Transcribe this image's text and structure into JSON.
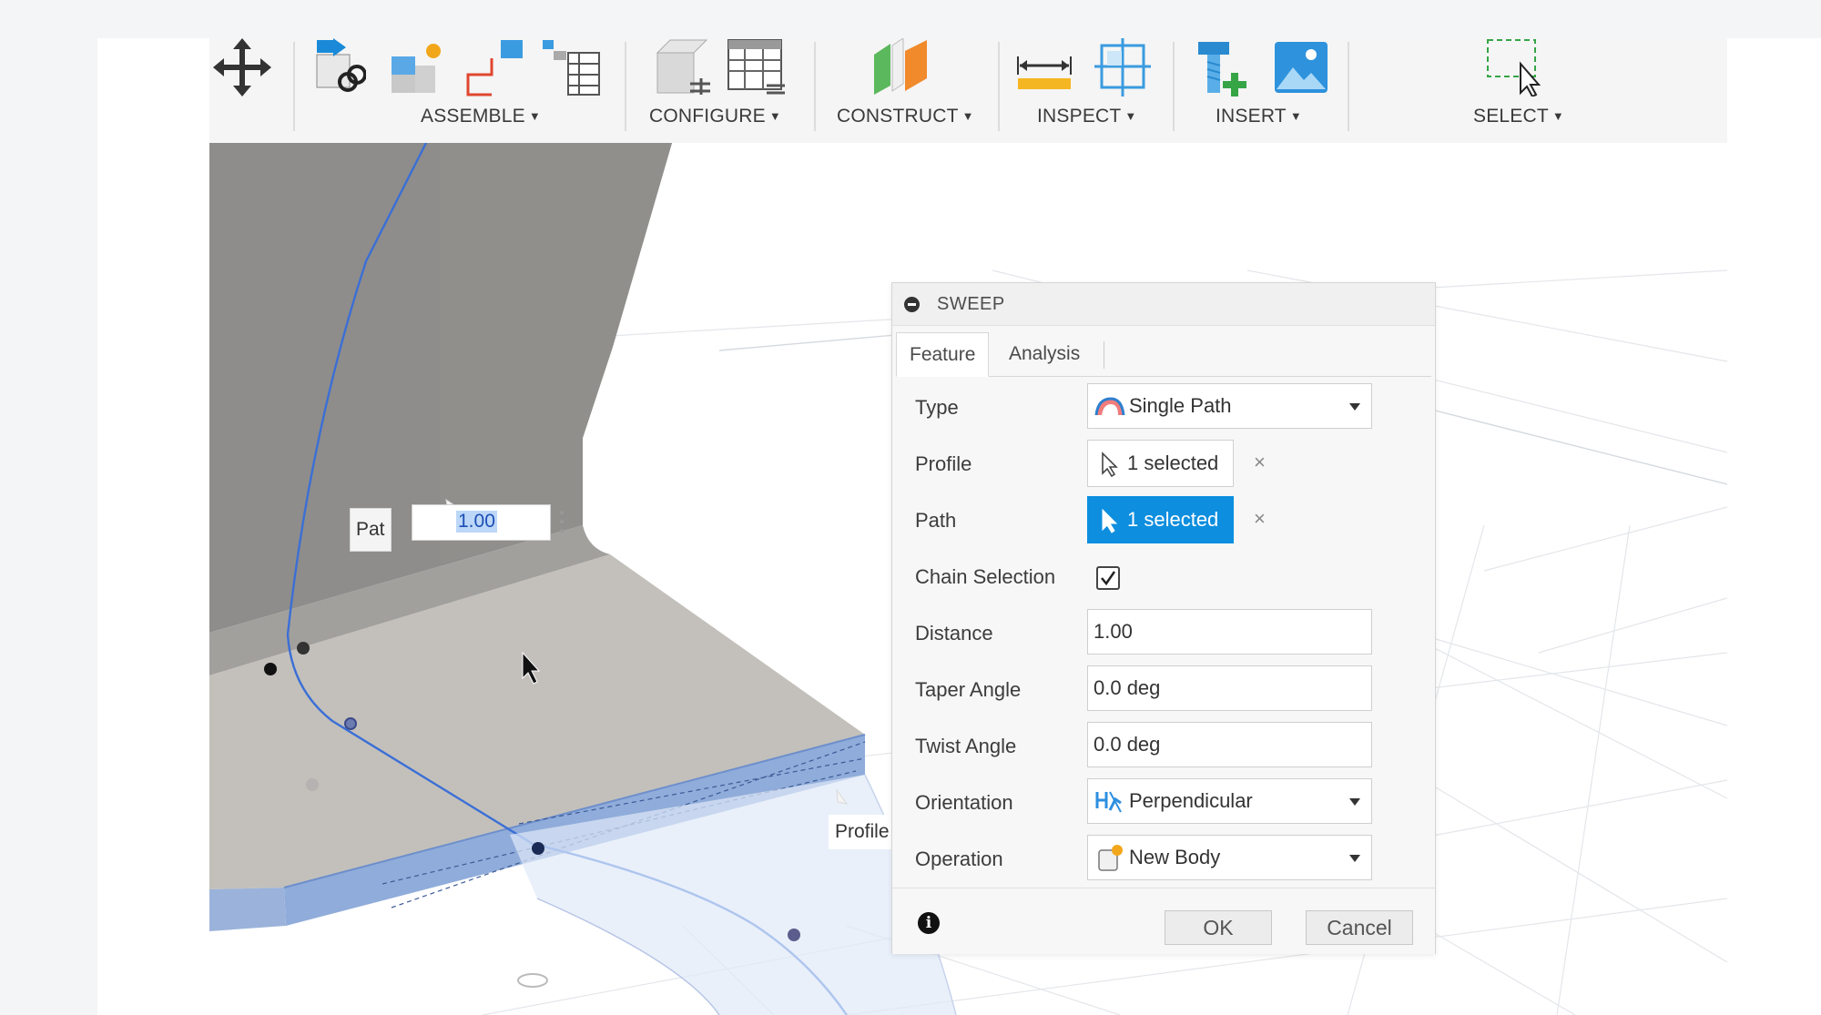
{
  "toolbar": {
    "groups": [
      {
        "label": "ASSEMBLE"
      },
      {
        "label": "CONFIGURE"
      },
      {
        "label": "CONSTRUCT"
      },
      {
        "label": "INSPECT"
      },
      {
        "label": "INSERT"
      },
      {
        "label": "SELECT"
      }
    ],
    "icons": [
      "move-icon",
      "joint-icon",
      "new-component-icon",
      "as-built-joint-icon",
      "component-table-icon",
      "configure-model-icon",
      "configure-table-icon",
      "construct-plane-icon",
      "measure-icon",
      "interference-icon",
      "insert-mcmaster-icon",
      "insert-canvas-icon",
      "select-window-icon"
    ]
  },
  "viewport": {
    "path_tag": "Pat",
    "path_value": "1.00",
    "profile_tag": "Profile"
  },
  "dialog": {
    "title": "SWEEP",
    "tabs": [
      {
        "label": "Feature"
      },
      {
        "label": "Analysis"
      }
    ],
    "rows": {
      "type": {
        "label": "Type",
        "value": "Single Path"
      },
      "profile": {
        "label": "Profile",
        "value": "1 selected"
      },
      "path": {
        "label": "Path",
        "value": "1 selected"
      },
      "chain": {
        "label": "Chain Selection",
        "checked": true
      },
      "distance": {
        "label": "Distance",
        "value": "1.00"
      },
      "taper": {
        "label": "Taper Angle",
        "value": "0.0 deg"
      },
      "twist": {
        "label": "Twist Angle",
        "value": "0.0 deg"
      },
      "orientation": {
        "label": "Orientation",
        "value": "Perpendicular"
      },
      "operation": {
        "label": "Operation",
        "value": "New Body"
      }
    },
    "clear_glyph": "×",
    "buttons": {
      "ok": "OK",
      "cancel": "Cancel"
    }
  },
  "colors": {
    "accent": "#0d8ede",
    "sweep_face": "#9bb3da",
    "path_line": "#3b6fd6"
  }
}
